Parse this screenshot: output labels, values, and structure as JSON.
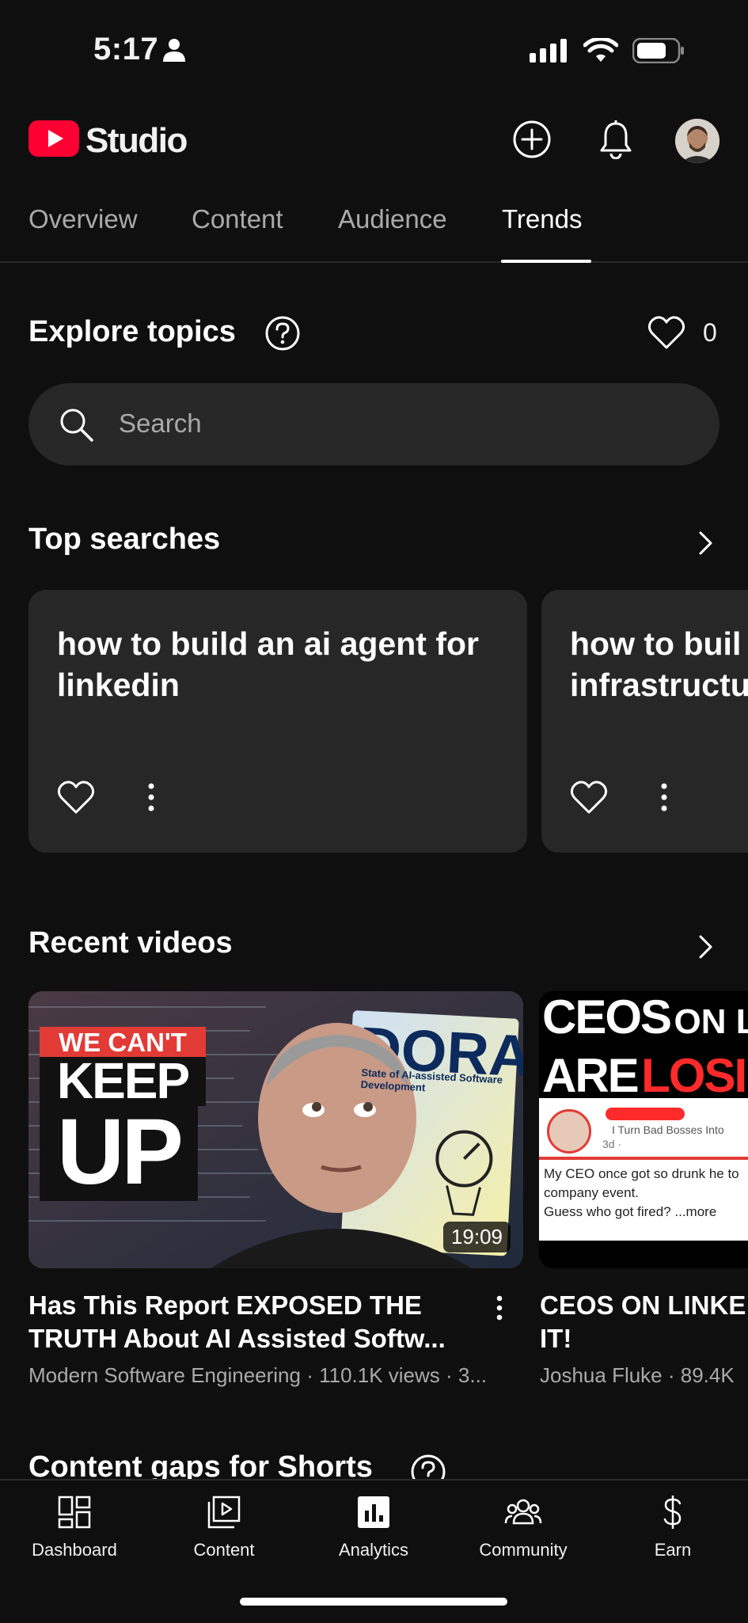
{
  "status_bar": {
    "time": "5:17"
  },
  "app": {
    "logo_text": "Studio"
  },
  "tabs": [
    {
      "label": "Overview"
    },
    {
      "label": "Content"
    },
    {
      "label": "Audience"
    },
    {
      "label": "Trends",
      "active": true
    }
  ],
  "explore": {
    "title": "Explore topics",
    "liked_count": "0",
    "search_placeholder": "Search"
  },
  "top_searches": {
    "title": "Top searches",
    "cards": [
      {
        "text": "how to build an ai agent for linkedin"
      },
      {
        "text": "how to buil\ninfrastructu"
      }
    ]
  },
  "recent_videos": {
    "title": "Recent videos",
    "videos": [
      {
        "title": "Has This Report EXPOSED THE TRUTH About AI Assisted Softw...",
        "meta": "Modern Software Engineering · 110.1K views · 3...",
        "duration": "19:09",
        "thumb_text": {
          "line1": "WE CAN'T",
          "line2": "KEEP",
          "line3": "UP",
          "brand": "DORA",
          "sub": "State of AI-assisted Software Development"
        }
      },
      {
        "title": "CEOS ON LINKE\nIT!",
        "meta": "Joshua Fluke · 89.4K",
        "thumb_text": {
          "line1a": "CEOS",
          "line1b": "ON LI",
          "line2a": "ARE",
          "line2b": "LOSIN",
          "post_text": "My CEO once got so drunk he to",
          "post_text2": "company event.",
          "post_text3": "Guess who got fired? ...more",
          "post_byline": "I Turn Bad Bosses Into",
          "post_age": "3d ·"
        }
      }
    ]
  },
  "content_gaps": {
    "title": "Content gaps for Shorts"
  },
  "bottom_nav": [
    {
      "label": "Dashboard"
    },
    {
      "label": "Content"
    },
    {
      "label": "Analytics"
    },
    {
      "label": "Community"
    },
    {
      "label": "Earn"
    }
  ],
  "colors": {
    "background": "#0f0f0f",
    "card": "#272727",
    "youtube_red": "#ff0033",
    "muted_text": "#aaaaaa"
  }
}
